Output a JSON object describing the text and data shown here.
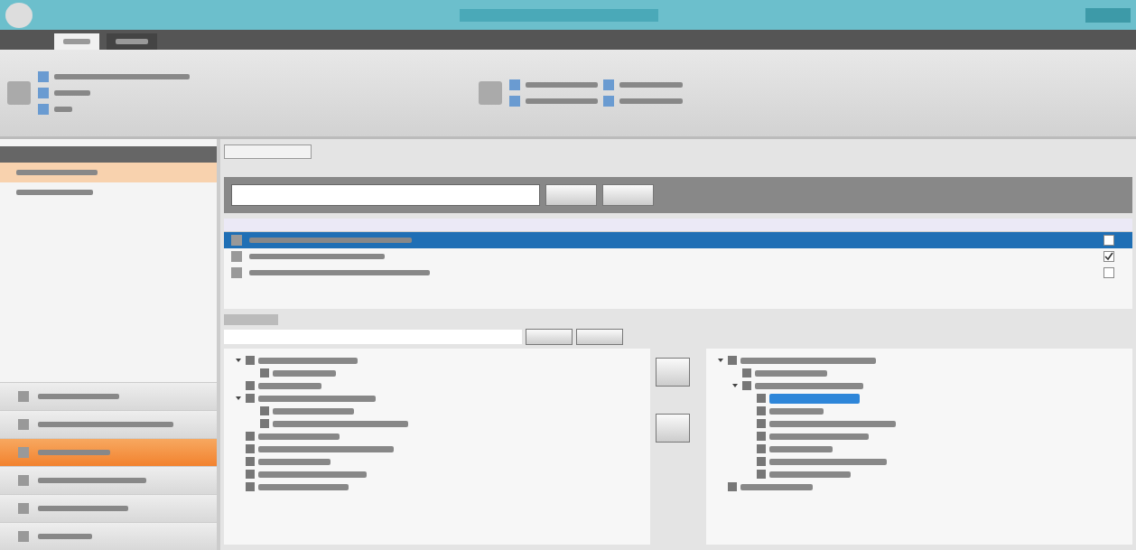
{
  "ribbon": {
    "tabs": [
      {
        "selected": true
      },
      {
        "selected": false
      }
    ]
  },
  "nav": {
    "items": [
      {
        "selected": true
      },
      {
        "selected": false
      }
    ]
  },
  "nav_sections": [
    {
      "selected": false
    },
    {
      "selected": false
    },
    {
      "selected": true
    },
    {
      "selected": false
    },
    {
      "selected": false
    },
    {
      "selected": false
    }
  ],
  "grid": {
    "rows": [
      {
        "selected": true,
        "checked": false
      },
      {
        "selected": false,
        "checked": true
      },
      {
        "selected": false,
        "checked": false
      }
    ]
  },
  "available_tree": [
    {
      "selected": false,
      "expanded": true,
      "children": [
        {
          "selected": false
        }
      ]
    },
    {
      "selected": false
    },
    {
      "selected": false,
      "expanded": true,
      "children": [
        {
          "selected": false
        },
        {
          "selected": false
        }
      ]
    },
    {
      "selected": false
    },
    {
      "selected": false
    },
    {
      "selected": false
    },
    {
      "selected": false
    },
    {
      "selected": false
    }
  ],
  "assigned_tree": [
    {
      "selected": false,
      "expanded": true,
      "children": [
        {
          "selected": false
        },
        {
          "selected": false,
          "expanded": true,
          "children": [
            {
              "selected": true
            },
            {
              "selected": false
            },
            {
              "selected": false
            },
            {
              "selected": false
            },
            {
              "selected": false
            },
            {
              "selected": false
            },
            {
              "selected": false
            }
          ]
        }
      ]
    },
    {
      "selected": false
    }
  ]
}
